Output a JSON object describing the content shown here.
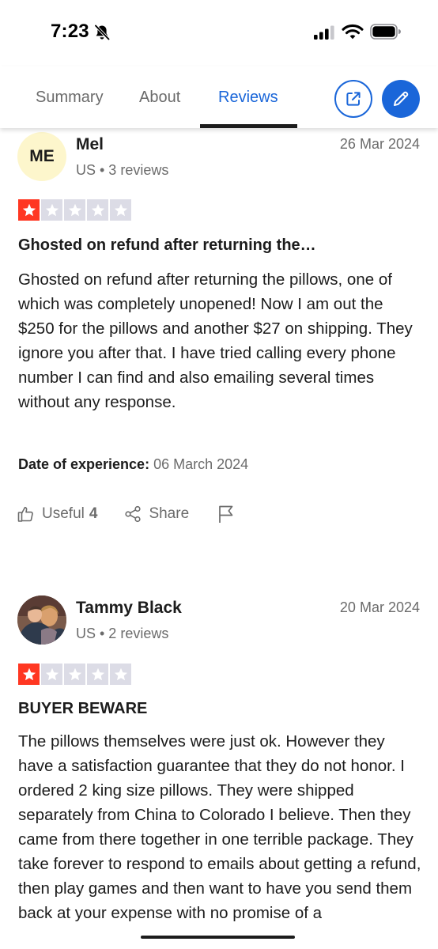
{
  "status_bar": {
    "time": "7:23",
    "icons": [
      "bell-slash-icon",
      "cellular-signal-icon",
      "wifi-icon",
      "battery-icon"
    ]
  },
  "tabs": {
    "items": [
      {
        "label": "Summary",
        "active": false
      },
      {
        "label": "About",
        "active": false
      },
      {
        "label": "Reviews",
        "active": true
      }
    ],
    "share_icon": "external-link-icon",
    "edit_icon": "pencil-icon"
  },
  "colors": {
    "accent": "#1a66d9",
    "star_filled": "#ff3722",
    "star_empty": "#dcdce6",
    "avatar_bg": "#fdf6cc"
  },
  "reviews": [
    {
      "initials": "ME",
      "name": "Mel",
      "meta": "US • 3 reviews",
      "date": "26 Mar 2024",
      "rating": 1,
      "title": "Ghosted on refund after returning the…",
      "body": "Ghosted on refund after returning the pillows, one of which was completely unopened! Now I am out the $250 for the pillows and another $27 on shipping. They ignore you after that. I have tried calling every phone number I can find and also emailing several times without any response.",
      "experience_label": "Date of experience:",
      "experience_date": "06 March 2024",
      "useful_label": "Useful",
      "useful_count": "4",
      "share_label": "Share"
    },
    {
      "name": "Tammy Black",
      "meta": "US • 2 reviews",
      "date": "20 Mar 2024",
      "rating": 1,
      "title": "BUYER BEWARE",
      "body": "The pillows themselves were just ok. However they have a satisfaction guarantee that they do not honor. I ordered 2 king size pillows. They were shipped separately from China to Colorado I believe. Then they came from there together in one terrible package. They take forever to respond to emails about getting a refund, then play games and then want to have you send them back at your expense with no promise of a"
    }
  ]
}
